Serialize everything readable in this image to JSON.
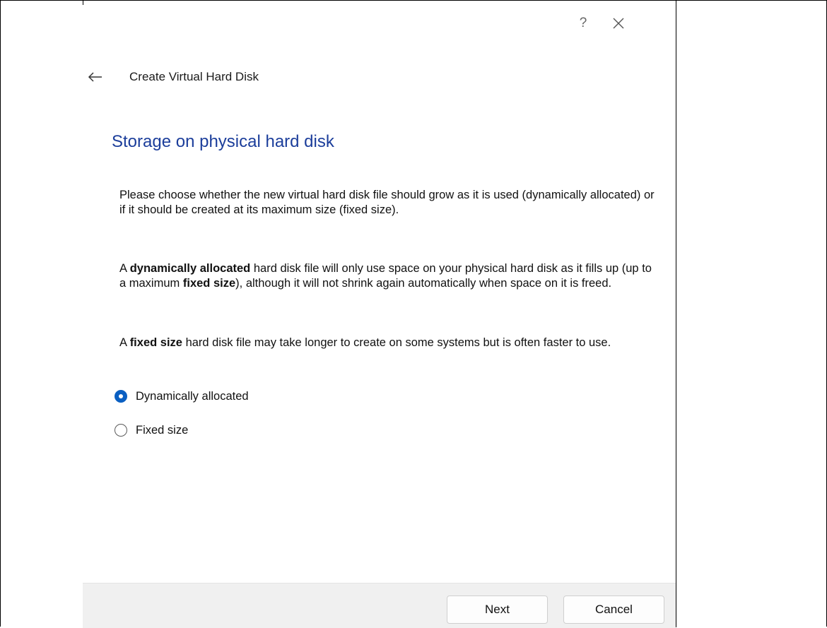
{
  "titlebar": {
    "help_label": "?",
    "close_icon": "close-icon"
  },
  "header": {
    "back_icon": "arrow-left-icon",
    "title": "Create Virtual Hard Disk"
  },
  "page": {
    "heading": "Storage on physical hard disk",
    "paragraph1": "Please choose whether the new virtual hard disk file should grow as it is used (dynamically allocated) or if it should be created at its maximum size (fixed size).",
    "paragraph2": {
      "prefix": "A ",
      "bold1": "dynamically allocated",
      "middle": " hard disk file will only use space on your physical hard disk as it fills up (up to a maximum ",
      "bold2": "fixed size",
      "suffix": "), although it will not shrink again automatically when space on it is freed."
    },
    "paragraph3": {
      "prefix": "A ",
      "bold": "fixed size",
      "suffix": " hard disk file may take longer to create on some systems but is often faster to use."
    }
  },
  "options": [
    {
      "label": "Dynamically allocated",
      "selected": true
    },
    {
      "label": "Fixed size",
      "selected": false
    }
  ],
  "footer": {
    "next_label": "Next",
    "cancel_label": "Cancel"
  },
  "colors": {
    "heading": "#1c3e9b",
    "radio_accent": "#0a5fc2",
    "footer_bg": "#f0f0f0"
  }
}
